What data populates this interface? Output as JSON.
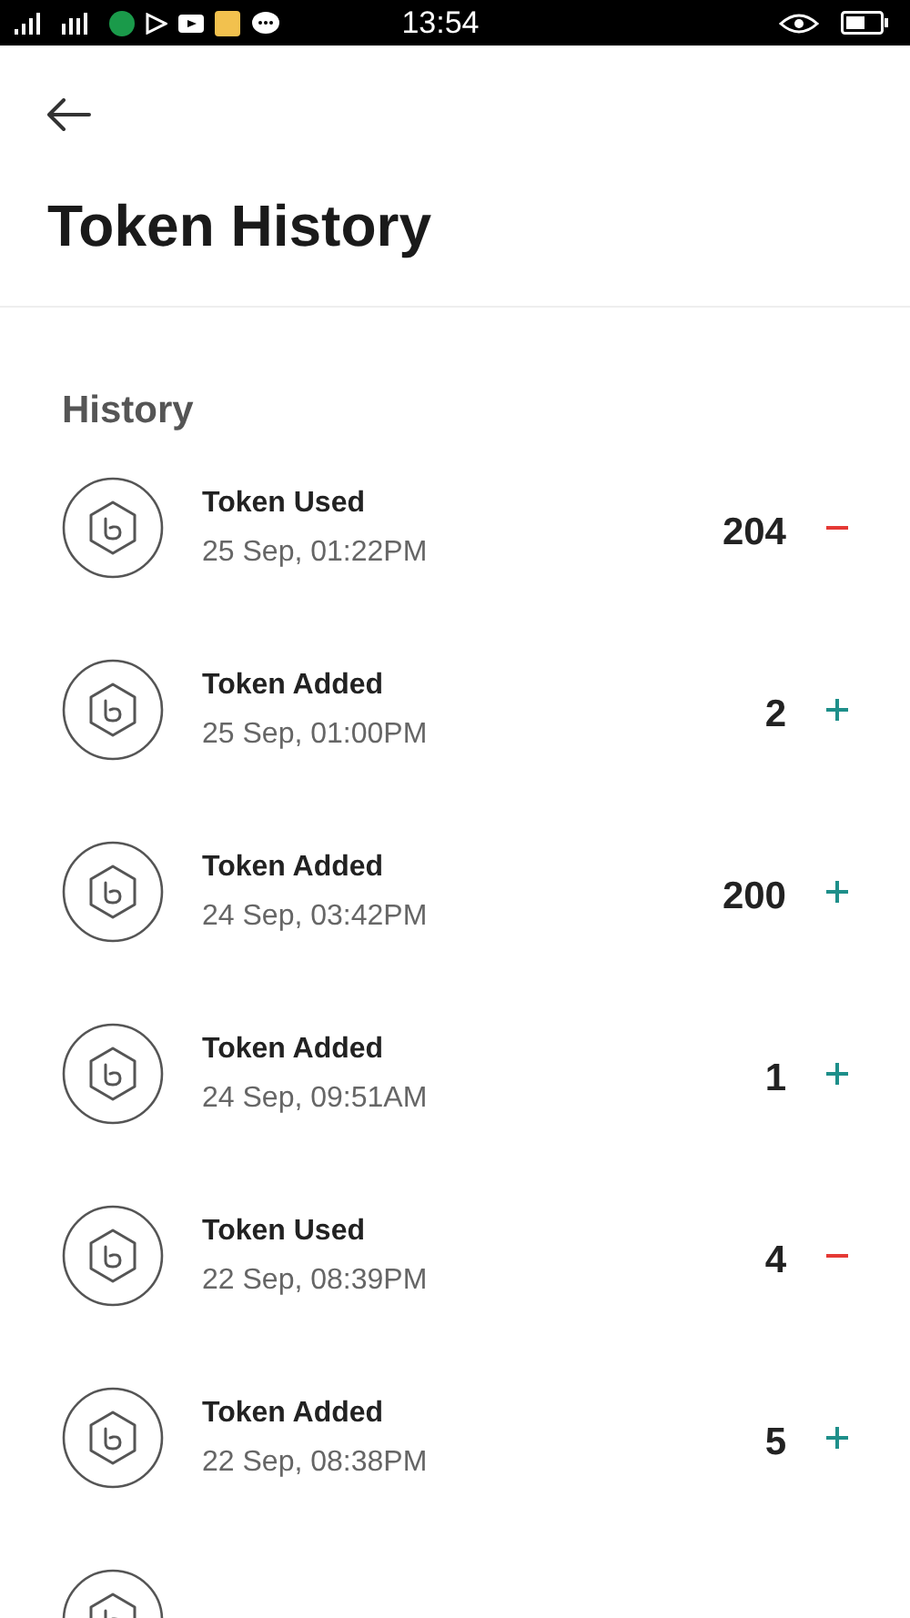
{
  "status_bar": {
    "time": "13:54"
  },
  "header": {
    "title": "Token History"
  },
  "section": {
    "title": "History"
  },
  "transactions": [
    {
      "kind": "used",
      "title": "Token Used",
      "date": "25 Sep, 01:22PM",
      "amount": "204"
    },
    {
      "kind": "added",
      "title": "Token Added",
      "date": "25 Sep, 01:00PM",
      "amount": "2"
    },
    {
      "kind": "added",
      "title": "Token Added",
      "date": "24 Sep, 03:42PM",
      "amount": "200"
    },
    {
      "kind": "added",
      "title": "Token Added",
      "date": "24 Sep, 09:51AM",
      "amount": "1"
    },
    {
      "kind": "used",
      "title": "Token Used",
      "date": "22 Sep, 08:39PM",
      "amount": "4"
    },
    {
      "kind": "added",
      "title": "Token Added",
      "date": "22 Sep, 08:38PM",
      "amount": "5"
    }
  ]
}
